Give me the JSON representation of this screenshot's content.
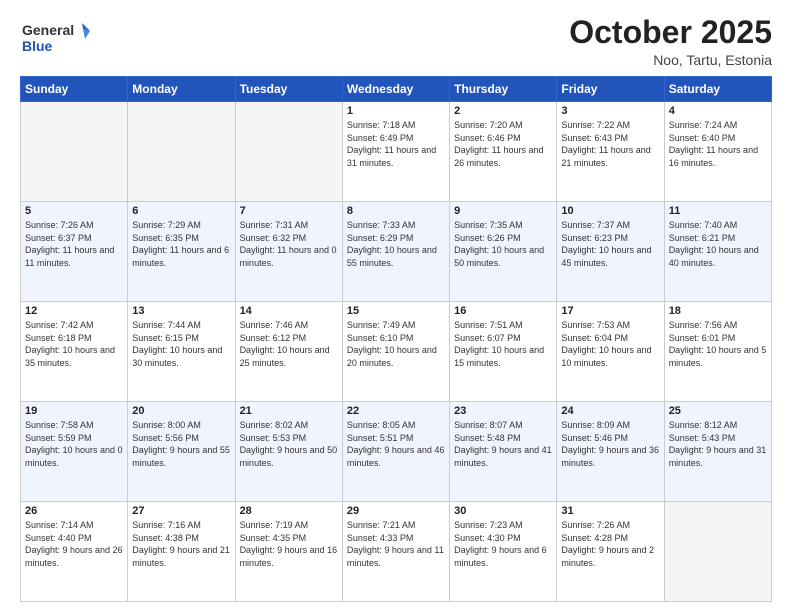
{
  "header": {
    "logo_general": "General",
    "logo_blue": "Blue",
    "month_title": "October 2025",
    "location": "Noo, Tartu, Estonia"
  },
  "days_of_week": [
    "Sunday",
    "Monday",
    "Tuesday",
    "Wednesday",
    "Thursday",
    "Friday",
    "Saturday"
  ],
  "weeks": [
    [
      {
        "day": "",
        "empty": true
      },
      {
        "day": "",
        "empty": true
      },
      {
        "day": "",
        "empty": true
      },
      {
        "day": "1",
        "sunrise": "7:18 AM",
        "sunset": "6:49 PM",
        "daylight": "11 hours and 31 minutes."
      },
      {
        "day": "2",
        "sunrise": "7:20 AM",
        "sunset": "6:46 PM",
        "daylight": "11 hours and 26 minutes."
      },
      {
        "day": "3",
        "sunrise": "7:22 AM",
        "sunset": "6:43 PM",
        "daylight": "11 hours and 21 minutes."
      },
      {
        "day": "4",
        "sunrise": "7:24 AM",
        "sunset": "6:40 PM",
        "daylight": "11 hours and 16 minutes."
      }
    ],
    [
      {
        "day": "5",
        "sunrise": "7:26 AM",
        "sunset": "6:37 PM",
        "daylight": "11 hours and 11 minutes."
      },
      {
        "day": "6",
        "sunrise": "7:29 AM",
        "sunset": "6:35 PM",
        "daylight": "11 hours and 6 minutes."
      },
      {
        "day": "7",
        "sunrise": "7:31 AM",
        "sunset": "6:32 PM",
        "daylight": "11 hours and 0 minutes."
      },
      {
        "day": "8",
        "sunrise": "7:33 AM",
        "sunset": "6:29 PM",
        "daylight": "10 hours and 55 minutes."
      },
      {
        "day": "9",
        "sunrise": "7:35 AM",
        "sunset": "6:26 PM",
        "daylight": "10 hours and 50 minutes."
      },
      {
        "day": "10",
        "sunrise": "7:37 AM",
        "sunset": "6:23 PM",
        "daylight": "10 hours and 45 minutes."
      },
      {
        "day": "11",
        "sunrise": "7:40 AM",
        "sunset": "6:21 PM",
        "daylight": "10 hours and 40 minutes."
      }
    ],
    [
      {
        "day": "12",
        "sunrise": "7:42 AM",
        "sunset": "6:18 PM",
        "daylight": "10 hours and 35 minutes."
      },
      {
        "day": "13",
        "sunrise": "7:44 AM",
        "sunset": "6:15 PM",
        "daylight": "10 hours and 30 minutes."
      },
      {
        "day": "14",
        "sunrise": "7:46 AM",
        "sunset": "6:12 PM",
        "daylight": "10 hours and 25 minutes."
      },
      {
        "day": "15",
        "sunrise": "7:49 AM",
        "sunset": "6:10 PM",
        "daylight": "10 hours and 20 minutes."
      },
      {
        "day": "16",
        "sunrise": "7:51 AM",
        "sunset": "6:07 PM",
        "daylight": "10 hours and 15 minutes."
      },
      {
        "day": "17",
        "sunrise": "7:53 AM",
        "sunset": "6:04 PM",
        "daylight": "10 hours and 10 minutes."
      },
      {
        "day": "18",
        "sunrise": "7:56 AM",
        "sunset": "6:01 PM",
        "daylight": "10 hours and 5 minutes."
      }
    ],
    [
      {
        "day": "19",
        "sunrise": "7:58 AM",
        "sunset": "5:59 PM",
        "daylight": "10 hours and 0 minutes."
      },
      {
        "day": "20",
        "sunrise": "8:00 AM",
        "sunset": "5:56 PM",
        "daylight": "9 hours and 55 minutes."
      },
      {
        "day": "21",
        "sunrise": "8:02 AM",
        "sunset": "5:53 PM",
        "daylight": "9 hours and 50 minutes."
      },
      {
        "day": "22",
        "sunrise": "8:05 AM",
        "sunset": "5:51 PM",
        "daylight": "9 hours and 46 minutes."
      },
      {
        "day": "23",
        "sunrise": "8:07 AM",
        "sunset": "5:48 PM",
        "daylight": "9 hours and 41 minutes."
      },
      {
        "day": "24",
        "sunrise": "8:09 AM",
        "sunset": "5:46 PM",
        "daylight": "9 hours and 36 minutes."
      },
      {
        "day": "25",
        "sunrise": "8:12 AM",
        "sunset": "5:43 PM",
        "daylight": "9 hours and 31 minutes."
      }
    ],
    [
      {
        "day": "26",
        "sunrise": "7:14 AM",
        "sunset": "4:40 PM",
        "daylight": "9 hours and 26 minutes."
      },
      {
        "day": "27",
        "sunrise": "7:16 AM",
        "sunset": "4:38 PM",
        "daylight": "9 hours and 21 minutes."
      },
      {
        "day": "28",
        "sunrise": "7:19 AM",
        "sunset": "4:35 PM",
        "daylight": "9 hours and 16 minutes."
      },
      {
        "day": "29",
        "sunrise": "7:21 AM",
        "sunset": "4:33 PM",
        "daylight": "9 hours and 11 minutes."
      },
      {
        "day": "30",
        "sunrise": "7:23 AM",
        "sunset": "4:30 PM",
        "daylight": "9 hours and 6 minutes."
      },
      {
        "day": "31",
        "sunrise": "7:26 AM",
        "sunset": "4:28 PM",
        "daylight": "9 hours and 2 minutes."
      },
      {
        "day": "",
        "empty": true
      }
    ]
  ]
}
